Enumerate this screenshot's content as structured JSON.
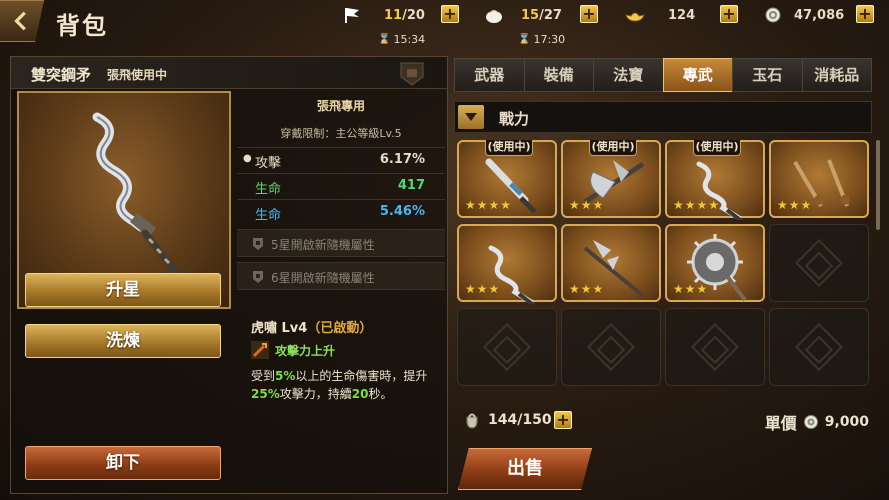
{
  "header": {
    "title": "背包",
    "stamina": {
      "current": "11",
      "max": "/20",
      "timer": "15:34"
    },
    "food": {
      "current": "15",
      "max": "/27",
      "timer": "17:30"
    },
    "gold": "124",
    "silver": "47,086"
  },
  "item": {
    "name": "雙突鋼矛",
    "status": "張飛使用中",
    "exclusive": "張飛專用",
    "requirement": "穿戴限制：主公等級Lv.5",
    "stars": 4,
    "stats": [
      {
        "key": "攻擊",
        "value": "6.17%",
        "color": "#e8dcc4"
      },
      {
        "key": "生命",
        "value": "417",
        "color": "#57d66a"
      },
      {
        "key": "生命",
        "value": "5.46%",
        "color": "#49b6ee"
      }
    ],
    "locked_attrs": [
      "5星開啟新隨機屬性",
      "6星開啟新隨機屬性"
    ],
    "skill": {
      "name": "虎嘯 Lv4",
      "active": "（已啟動）",
      "buff": "攻擊力上升",
      "desc_parts": [
        "受到",
        "5%",
        "以上的生命傷害時，提升",
        "25%",
        "攻擊力，持續",
        "20",
        "秒。"
      ]
    }
  },
  "buttons": {
    "upgrade_star": "升星",
    "refine": "洗煉",
    "unequip": "卸下",
    "sell": "出售"
  },
  "tabs": [
    "武器",
    "裝備",
    "法寶",
    "專武",
    "玉石",
    "消耗品"
  ],
  "active_tab": "專武",
  "filter_label": "戰力",
  "grid": [
    {
      "in_use": "(使用中)",
      "stars": 4,
      "kind": "sword"
    },
    {
      "in_use": "(使用中)",
      "stars": 3,
      "kind": "axe"
    },
    {
      "in_use": "(使用中)",
      "stars": 4,
      "kind": "kris"
    },
    {
      "in_use": "",
      "stars": 3,
      "kind": "twin"
    },
    {
      "in_use": "",
      "stars": 3,
      "kind": "kris"
    },
    {
      "in_use": "",
      "stars": 3,
      "kind": "halberd"
    },
    {
      "in_use": "",
      "stars": 3,
      "kind": "shield"
    },
    {
      "empty": true
    },
    {
      "empty": true
    },
    {
      "empty": true
    },
    {
      "empty": true
    },
    {
      "empty": true
    }
  ],
  "capacity": "144/150",
  "unit_price_label": "單價",
  "unit_price": "9,000"
}
